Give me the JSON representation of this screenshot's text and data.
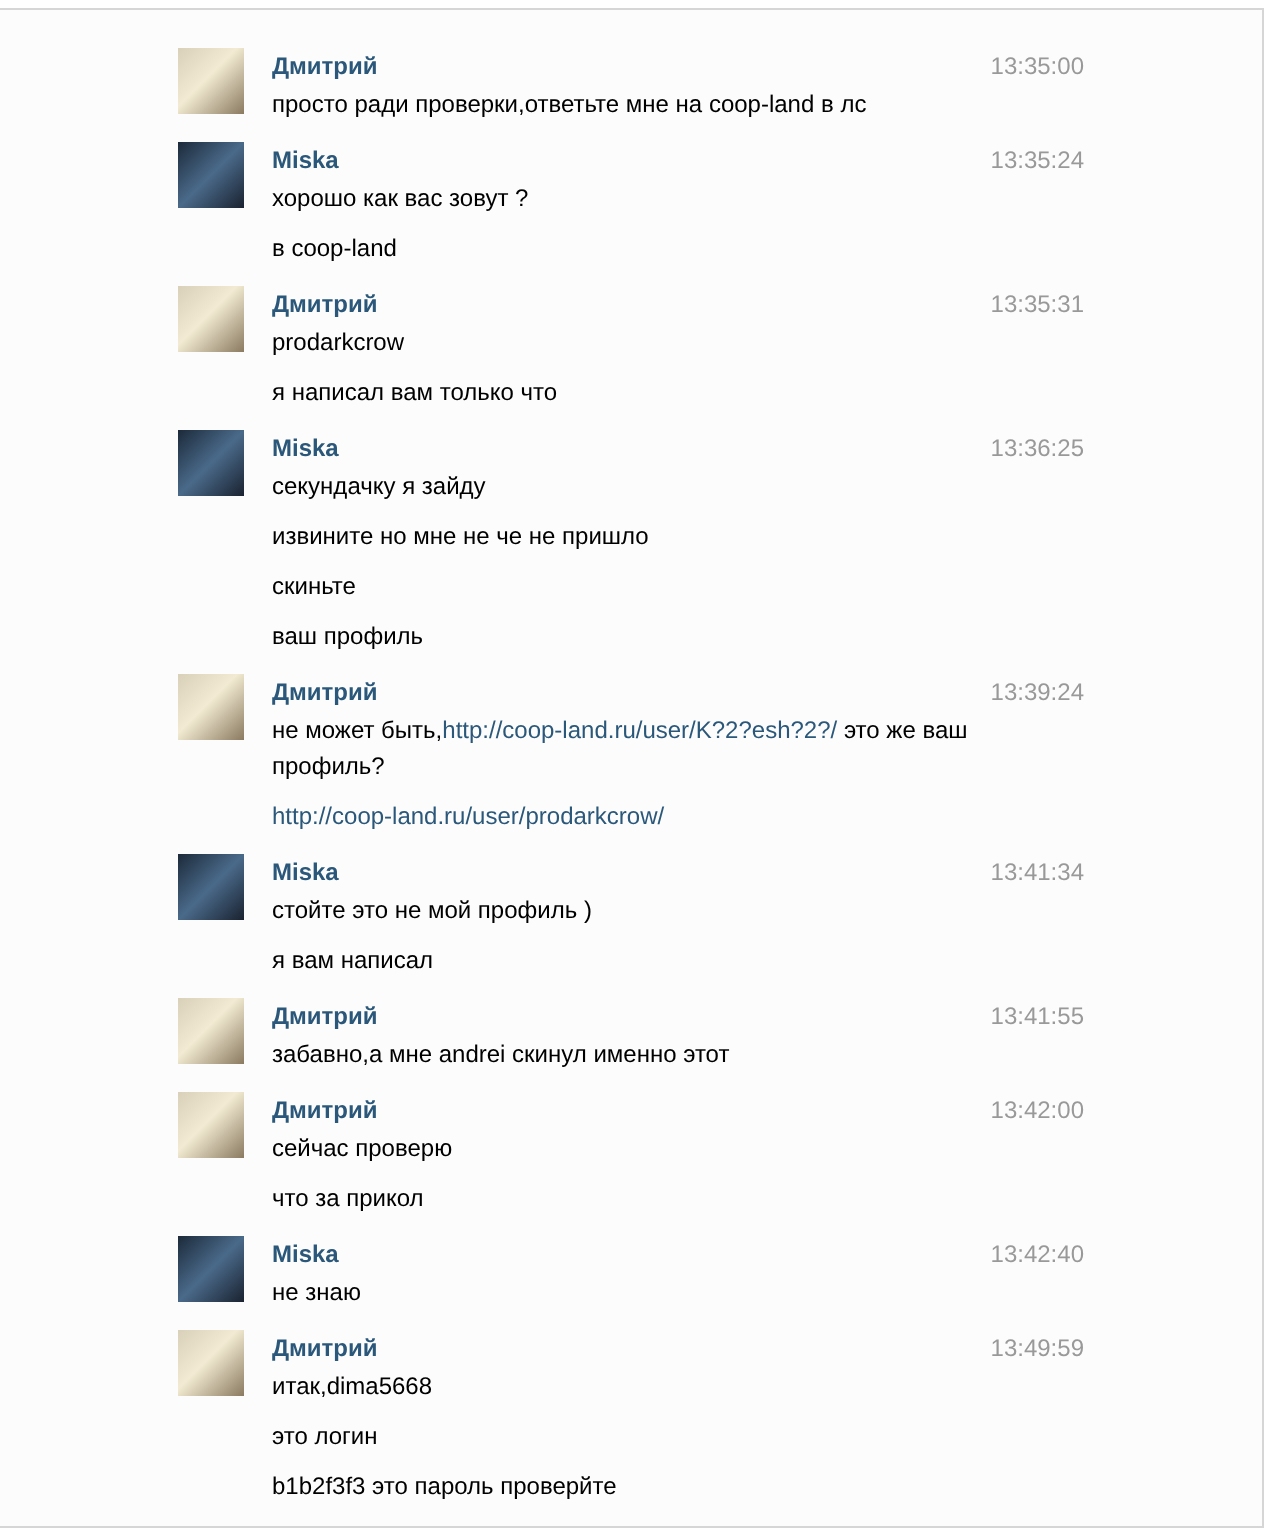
{
  "messages": [
    {
      "author": "Дмитрий",
      "kind": "light",
      "time": "13:35:00",
      "lines": [
        [
          {
            "kind": "text",
            "text": "просто ради проверки,ответьте мне на coop-land в лс"
          }
        ]
      ]
    },
    {
      "author": "Miska",
      "kind": "dark",
      "time": "13:35:24",
      "lines": [
        [
          {
            "kind": "text",
            "text": "хорошо как вас зовут ?"
          }
        ],
        [
          {
            "kind": "text",
            "text": "в coop-land"
          }
        ]
      ]
    },
    {
      "author": "Дмитрий",
      "kind": "light",
      "time": "13:35:31",
      "lines": [
        [
          {
            "kind": "text",
            "text": "prodarkcrow"
          }
        ],
        [
          {
            "kind": "text",
            "text": "я написал вам только что"
          }
        ]
      ]
    },
    {
      "author": "Miska",
      "kind": "dark",
      "time": "13:36:25",
      "lines": [
        [
          {
            "kind": "text",
            "text": "секундачку я зайду"
          }
        ],
        [
          {
            "kind": "text",
            "text": "извините но мне не че не пришло"
          }
        ],
        [
          {
            "kind": "text",
            "text": "скиньте"
          }
        ],
        [
          {
            "kind": "text",
            "text": "ваш профиль"
          }
        ]
      ]
    },
    {
      "author": "Дмитрий",
      "kind": "light",
      "time": "13:39:24",
      "lines": [
        [
          {
            "kind": "text",
            "text": "не может быть,"
          },
          {
            "kind": "link",
            "text": "http://coop-land.ru/user/K?2?esh?2?/"
          },
          {
            "kind": "text",
            "text": " это же ваш профиль?"
          }
        ],
        [
          {
            "kind": "link",
            "text": "http://coop-land.ru/user/prodarkcrow/"
          }
        ]
      ]
    },
    {
      "author": "Miska",
      "kind": "dark",
      "time": "13:41:34",
      "lines": [
        [
          {
            "kind": "text",
            "text": "стойте это не мой профиль )"
          }
        ],
        [
          {
            "kind": "text",
            "text": "я вам написал"
          }
        ]
      ]
    },
    {
      "author": "Дмитрий",
      "kind": "light",
      "time": "13:41:55",
      "lines": [
        [
          {
            "kind": "text",
            "text": "забавно,а мне andrei скинул именно этот"
          }
        ]
      ]
    },
    {
      "author": "Дмитрий",
      "kind": "light",
      "time": "13:42:00",
      "lines": [
        [
          {
            "kind": "text",
            "text": "сейчас проверю"
          }
        ],
        [
          {
            "kind": "text",
            "text": "что за прикол"
          }
        ]
      ]
    },
    {
      "author": "Miska",
      "kind": "dark",
      "time": "13:42:40",
      "lines": [
        [
          {
            "kind": "text",
            "text": "не знаю"
          }
        ]
      ]
    },
    {
      "author": "Дмитрий",
      "kind": "light",
      "time": "13:49:59",
      "lines": [
        [
          {
            "kind": "text",
            "text": "итак,dima5668"
          }
        ],
        [
          {
            "kind": "text",
            "text": "это логин"
          }
        ],
        [
          {
            "kind": "text",
            "text": "b1b2f3f3 это пароль проверйте"
          }
        ]
      ]
    }
  ]
}
